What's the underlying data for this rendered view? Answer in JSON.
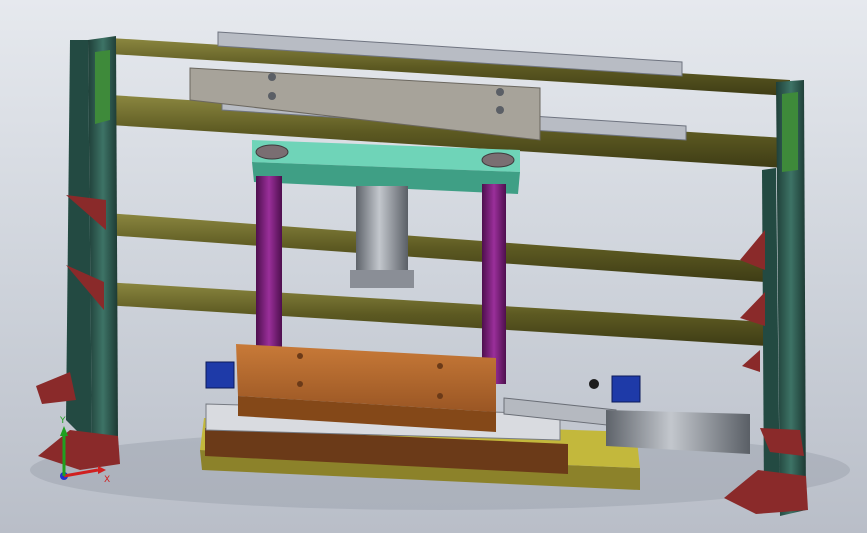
{
  "viewport": {
    "background_top": "#e6e9ee",
    "background_bottom": "#b9bec8"
  },
  "model": {
    "frame_color": "#2f5a4f",
    "rail_color": "#6e6a2e",
    "foot_color": "#8a2a2a",
    "top_plate_color": "#4bb79a",
    "guide_rod_color": "#7a1f7a",
    "fixture_plate_color": "#b56a2e",
    "base_plate_color": "#a59a32",
    "cylinder_color": "#8f949c",
    "valve_color": "#1e3aa8"
  },
  "triad": {
    "x_label": "X",
    "y_label": "Y",
    "x_color": "#d02020",
    "y_color": "#20a020",
    "z_color": "#2030d0"
  }
}
